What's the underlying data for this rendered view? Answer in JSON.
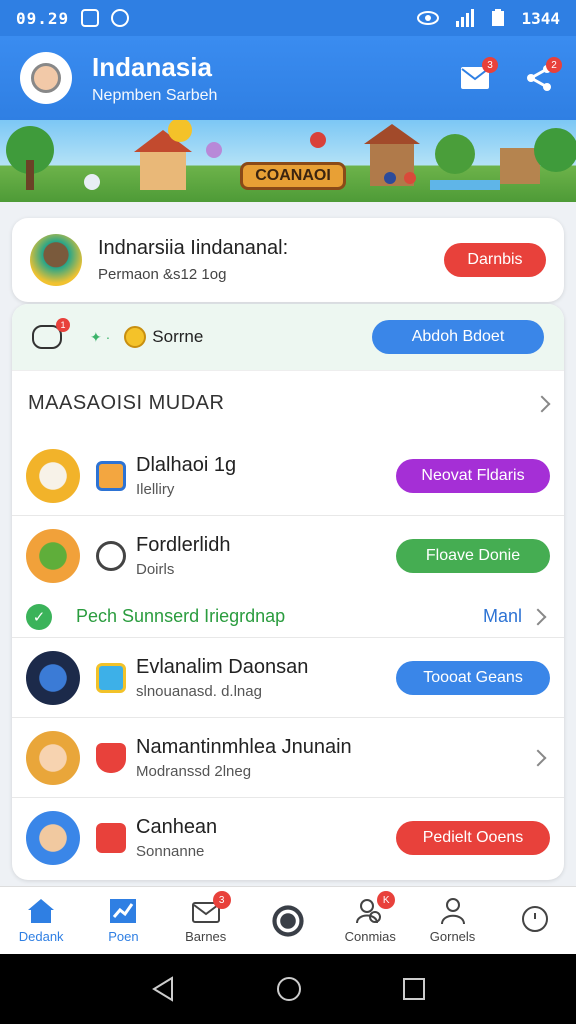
{
  "status_bar": {
    "time": "09.29",
    "battery": "1344"
  },
  "header": {
    "title": "Indanasia",
    "subtitle": "Nepmben Sarbeh",
    "mail_badge": "3",
    "share_badge": "2"
  },
  "banner": {
    "label": "COANAOI"
  },
  "profile": {
    "name": "Indnarsiia Iindananal:",
    "subtitle": "Permaon &s12 1og",
    "button": "Darnbis"
  },
  "score_strip": {
    "badge": "1",
    "score": "Sorrne",
    "button": "Abdoh Bdoet"
  },
  "section": {
    "title": "MAASAOISI MUDAR"
  },
  "rows": [
    {
      "name": "Dlalhaoi 1g",
      "sub": "Ilelliry",
      "button": "Neovat Fldaris",
      "button_color": "#a52fd6"
    },
    {
      "name": "Fordlerlidh",
      "sub": "Doirls",
      "button": "Floave Donie",
      "button_color": "#45ad52"
    },
    {
      "name": "Evlanalim Daonsan",
      "sub": "slnouanasd. d.lnag",
      "button": "Toooat Geans",
      "button_color": "#3a86e8"
    },
    {
      "name": "Namantinmhlea Jnunain",
      "sub": "Modranssd 2lneg"
    },
    {
      "name": "Canhean",
      "sub": "Sonnanne",
      "button": "Pedielt Ooens",
      "button_color": "#e8413b"
    }
  ],
  "notice": {
    "text": "Pech Sunnserd Iriegrdnap",
    "more": "Manl"
  },
  "bottom_nav": [
    {
      "label": "Dedank"
    },
    {
      "label": "Poen"
    },
    {
      "label": "Barnes",
      "badge": "3"
    },
    {
      "label": ""
    },
    {
      "label": "Conmias",
      "badge": "K"
    },
    {
      "label": "Gornels"
    },
    {
      "label": ""
    }
  ]
}
